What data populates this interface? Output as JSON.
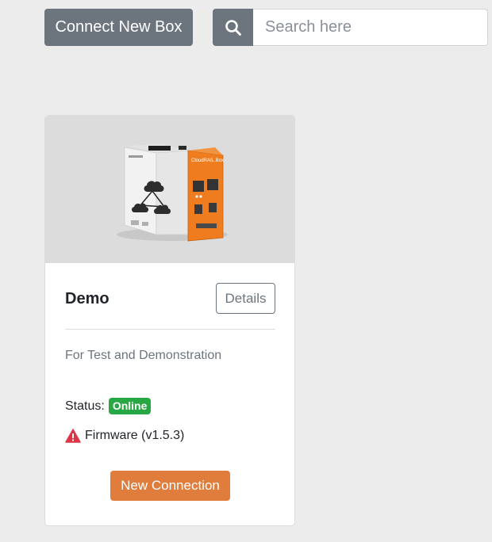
{
  "toolbar": {
    "connect_label": "Connect New Box"
  },
  "search": {
    "placeholder": "Search here",
    "value": ""
  },
  "card": {
    "device_label": "CloudRAIL.Box",
    "title": "Demo",
    "details_label": "Details",
    "description": "For Test and Demonstration",
    "status_label": "Status:",
    "status_value": "Online",
    "firmware_label": "Firmware (v1.5.3)",
    "new_connection_label": "New Connection"
  },
  "icons": {
    "search": "search-icon",
    "warning": "warning-icon",
    "device": "device-image"
  },
  "colors": {
    "secondary": "#6c757d",
    "success": "#28a745",
    "danger": "#dc3545",
    "accent": "#e07c3c",
    "background": "#ececec"
  }
}
